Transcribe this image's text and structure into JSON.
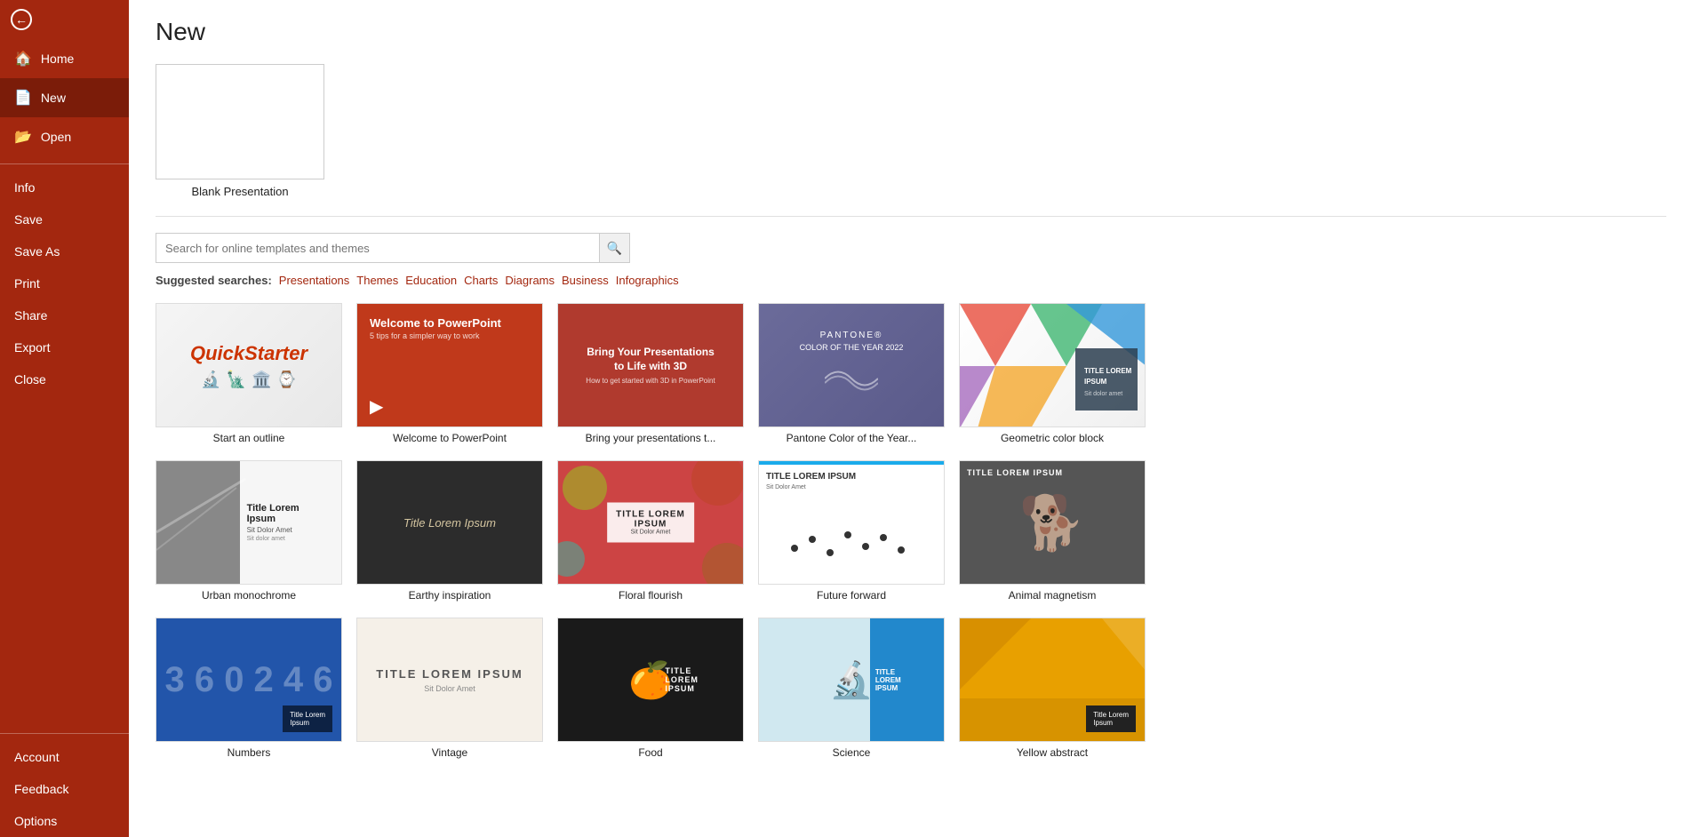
{
  "sidebar": {
    "back_label": "",
    "nav_items": [
      {
        "id": "home",
        "label": "Home",
        "icon": "🏠"
      },
      {
        "id": "new",
        "label": "New",
        "icon": "📄",
        "active": true
      },
      {
        "id": "open",
        "label": "Open",
        "icon": "📂"
      }
    ],
    "text_items": [
      {
        "id": "info",
        "label": "Info"
      },
      {
        "id": "save",
        "label": "Save"
      },
      {
        "id": "save-as",
        "label": "Save As"
      },
      {
        "id": "print",
        "label": "Print"
      },
      {
        "id": "share",
        "label": "Share"
      },
      {
        "id": "export",
        "label": "Export"
      },
      {
        "id": "close",
        "label": "Close"
      }
    ],
    "bottom_items": [
      {
        "id": "account",
        "label": "Account"
      },
      {
        "id": "feedback",
        "label": "Feedback"
      },
      {
        "id": "options",
        "label": "Options"
      }
    ]
  },
  "page": {
    "title": "New"
  },
  "blank_presentation": {
    "label": "Blank Presentation"
  },
  "search": {
    "placeholder": "Search for online templates and themes"
  },
  "suggested_searches": {
    "label": "Suggested searches:",
    "items": [
      "Presentations",
      "Themes",
      "Education",
      "Charts",
      "Diagrams",
      "Business",
      "Infographics"
    ]
  },
  "templates": [
    {
      "id": "quickstarter",
      "label": "Start an outline"
    },
    {
      "id": "welcome-ppt",
      "label": "Welcome to PowerPoint"
    },
    {
      "id": "bring3d",
      "label": "Bring your presentations t..."
    },
    {
      "id": "pantone",
      "label": "Pantone Color of the Year..."
    },
    {
      "id": "geometric",
      "label": "Geometric color block"
    },
    {
      "id": "urban",
      "label": "Urban monochrome"
    },
    {
      "id": "earthy",
      "label": "Earthy inspiration"
    },
    {
      "id": "floral",
      "label": "Floral flourish"
    },
    {
      "id": "future",
      "label": "Future forward"
    },
    {
      "id": "animal",
      "label": "Animal magnetism"
    },
    {
      "id": "numbers",
      "label": "Numbers"
    },
    {
      "id": "vintage",
      "label": "Vintage"
    },
    {
      "id": "food",
      "label": "Food"
    },
    {
      "id": "science",
      "label": "Science"
    },
    {
      "id": "yellow",
      "label": "Yellow abstract"
    }
  ]
}
